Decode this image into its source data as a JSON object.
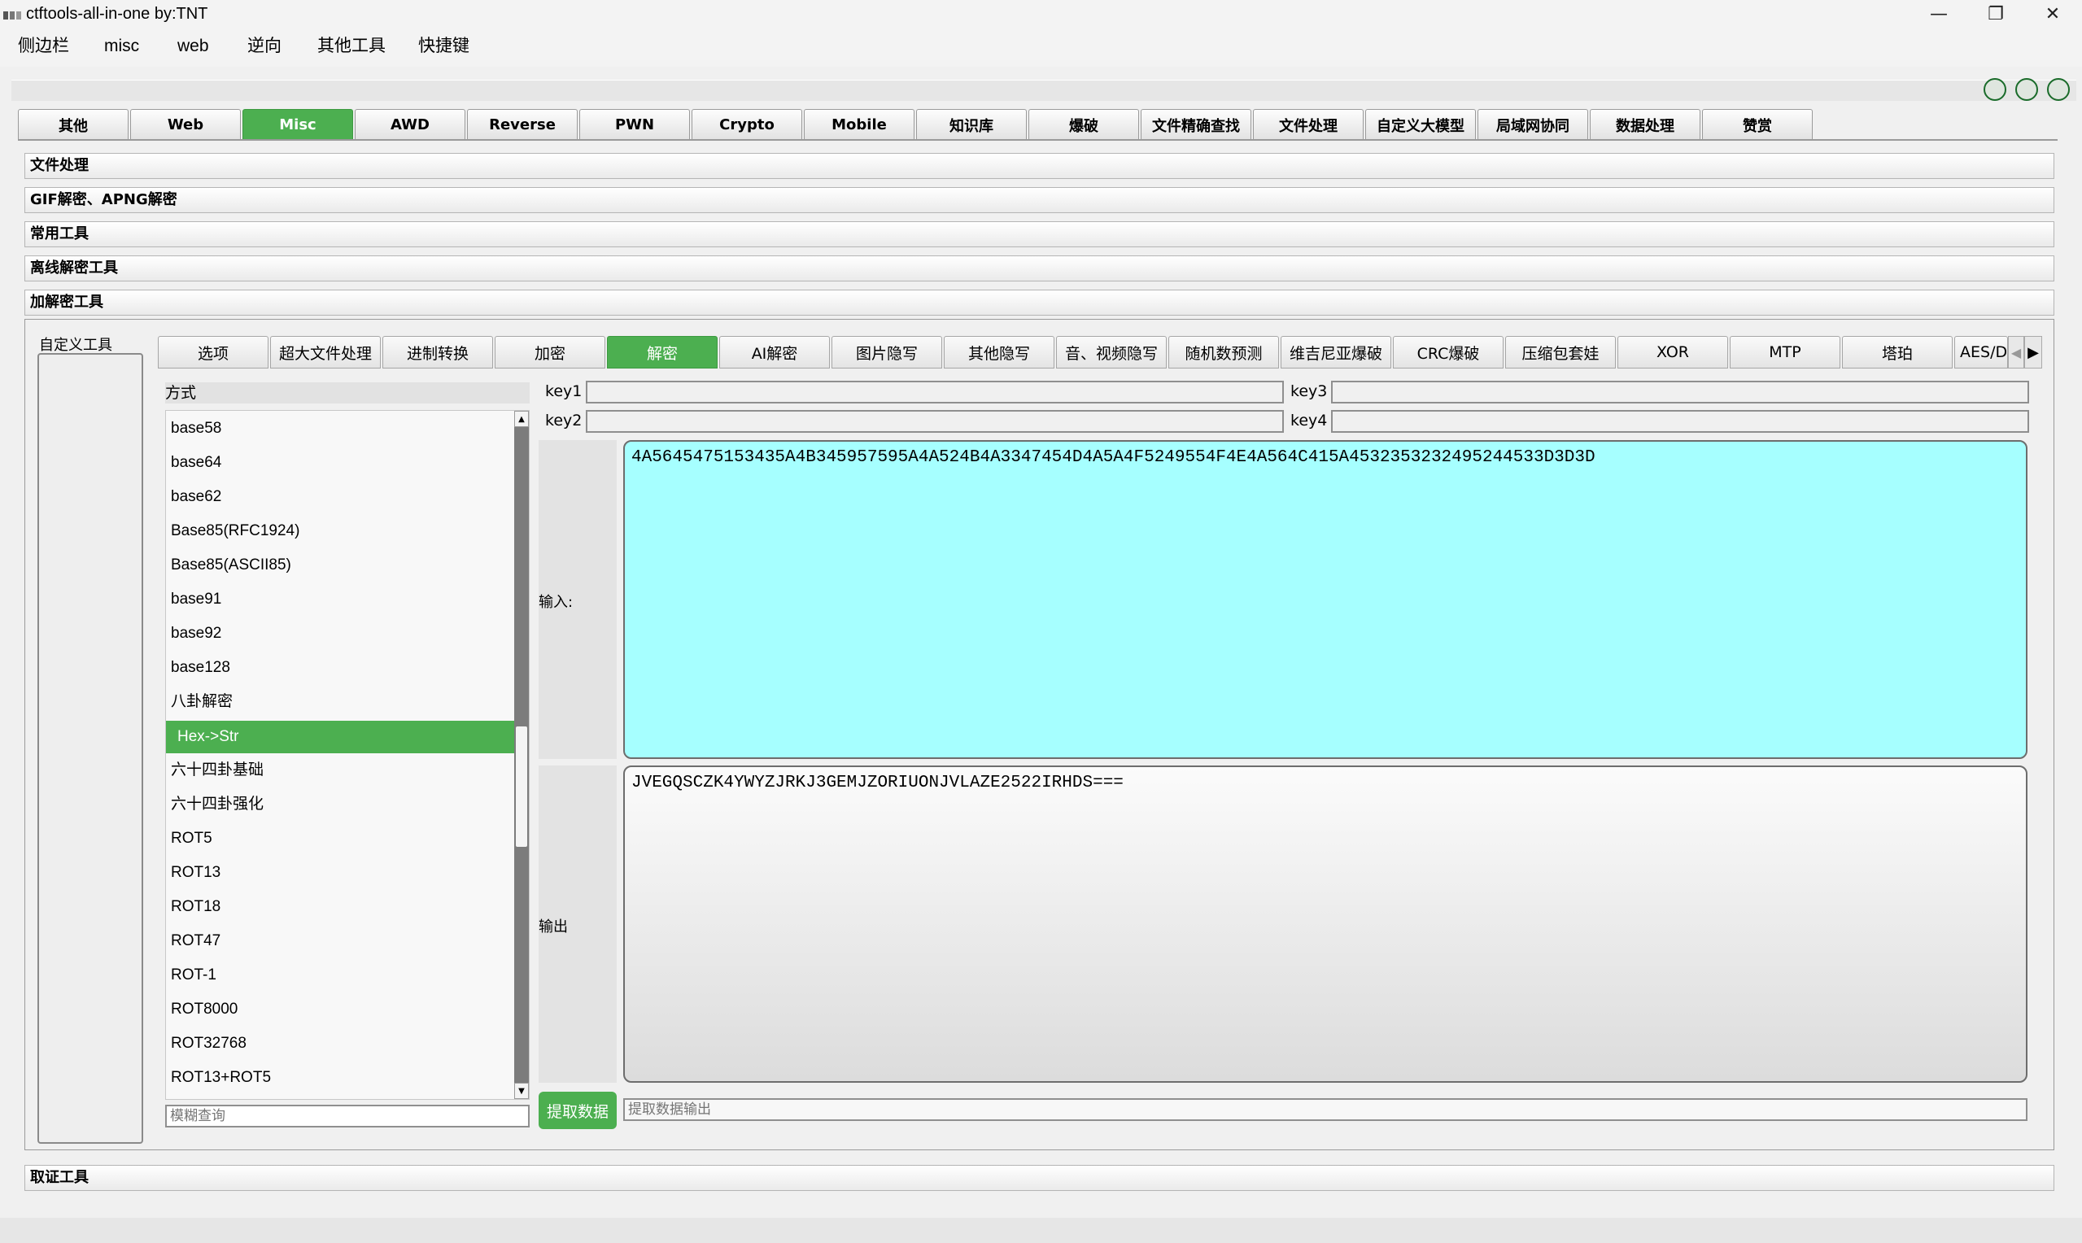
{
  "window": {
    "title": "ctftools-all-in-one   by:TNT",
    "minimize": "—",
    "restore": "❐",
    "close": "✕"
  },
  "menu": [
    "侧边栏",
    "misc",
    "web",
    "逆向",
    "其他工具",
    "快捷键"
  ],
  "top_tabs": {
    "items": [
      "其他",
      "Web",
      "Misc",
      "AWD",
      "Reverse",
      "PWN",
      "Crypto",
      "Mobile",
      "知识库",
      "爆破",
      "文件精确查找",
      "文件处理",
      "自定义大模型",
      "局域网协同",
      "数据处理",
      "赞赏"
    ],
    "active": "Misc"
  },
  "accordion": {
    "items": [
      "文件处理",
      "GIF解密、APNG解密",
      "常用工具",
      "离线解密工具",
      "加解密工具"
    ],
    "bottom": "取证工具"
  },
  "sidebar": {
    "label": "自定义工具"
  },
  "sub_tabs": {
    "items": [
      "选项",
      "超大文件处理",
      "进制转换",
      "加密",
      "解密",
      "AI解密",
      "图片隐写",
      "其他隐写",
      "音、视频隐写",
      "随机数预测",
      "维吉尼亚爆破",
      "CRC爆破",
      "压缩包套娃",
      "XOR",
      "MTP",
      "塔珀",
      "AES/D"
    ],
    "active": "解密",
    "scroll_left": "◀",
    "scroll_right": "▶"
  },
  "method": {
    "header": "方式",
    "items": [
      "base58",
      "base64",
      "base62",
      "Base85(RFC1924)",
      "Base85(ASCII85)",
      "base91",
      "base92",
      "base128",
      "八卦解密",
      "Hex->Str",
      "六十四卦基础",
      "六十四卦强化",
      "ROT5",
      "ROT13",
      "ROT18",
      "ROT47",
      "ROT-1",
      "ROT8000",
      "ROT32768",
      "ROT13+ROT5"
    ],
    "selected": "Hex->Str",
    "search_placeholder": "模糊查询"
  },
  "keys": {
    "key1": "key1",
    "key2": "key2",
    "key3": "key3",
    "key4": "key4"
  },
  "io": {
    "input_label": "输入:",
    "input_value": "4A5645475153435A4B345957595A4A524B4A3347454D4A5A4F5249554F4E4A564C415A4532353232495244533D3D3D",
    "output_label": "输出",
    "output_value": "JVEGQSCZK4YWYZJRKJ3GEMJZORIUONJVLAZE2522IRHDS==="
  },
  "extract": {
    "button": "提取数据",
    "output_placeholder": "提取数据输出"
  },
  "colors": {
    "accent_green": "#4caf50",
    "input_bg": "#a6ffff"
  }
}
